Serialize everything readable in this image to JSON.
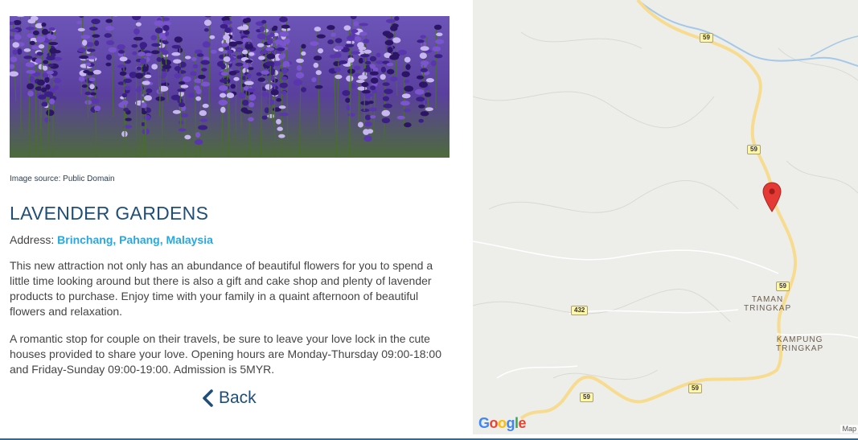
{
  "hero": {
    "image_alt": "Lavender flowers"
  },
  "image_source": "Image source: Public Domain",
  "title": "LAVENDER GARDENS",
  "address": {
    "label": "Address:",
    "value": "Brinchang, Pahang, Malaysia"
  },
  "paragraphs": [
    "This new attraction not only has an abundance of beautiful flowers for you to spend a little time looking around but there is also a gift and cake shop and plenty of lavender products to purchase. Enjoy time with your family in a quaint afternoon of beautiful flowers and relaxation.",
    "A romantic stop for couple on their travels, be sure to leave your love lock in the cute houses provided to share your love. Opening hours are Monday-Thursday 09:00-18:00 and Friday-Sunday 09:00-19:00. Admission is 5MYR."
  ],
  "back": {
    "label": "Back",
    "icon": "chevron-left-icon"
  },
  "map": {
    "places": [
      "TAMAN\nTRINGKAP",
      "KAMPUNG\nTRINGKAP"
    ],
    "road_shields": [
      "59",
      "59",
      "59",
      "59",
      "59",
      "432"
    ],
    "google_letters": [
      "G",
      "o",
      "o",
      "g",
      "l",
      "e"
    ],
    "attribution": "Map",
    "marker_icon": "map-pin-icon",
    "colors": {
      "road": "#f7dc8f",
      "water": "#a4c8e8",
      "land": "#ededea",
      "pin": "#e53935"
    }
  }
}
